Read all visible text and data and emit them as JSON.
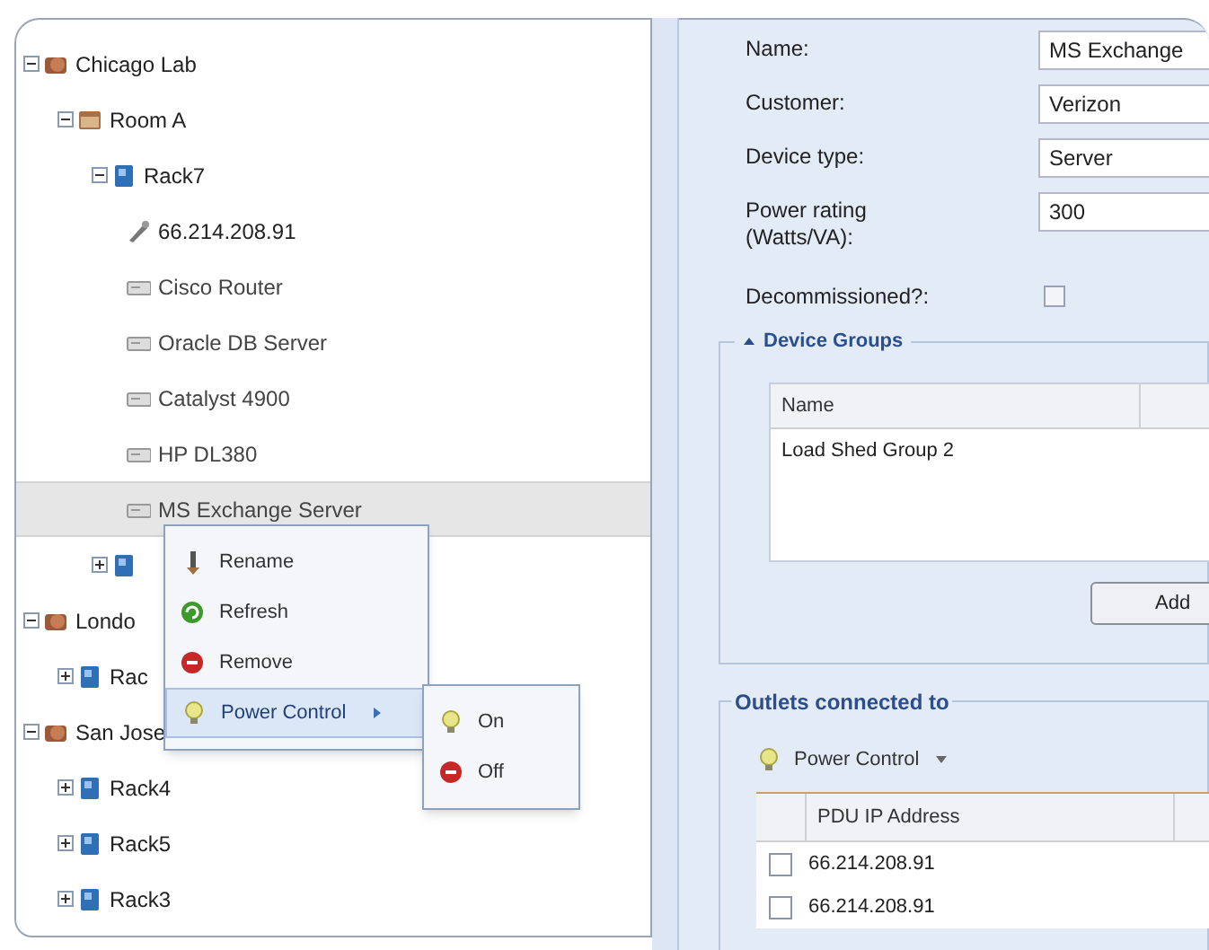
{
  "tree": [
    {
      "label": "Chicago Lab",
      "kind": "site",
      "expanded": true,
      "selected": false,
      "children": [
        {
          "label": "Room A",
          "kind": "room",
          "expanded": true,
          "selected": false,
          "children": [
            {
              "label": "Rack7",
              "kind": "rack",
              "expanded": true,
              "selected": false,
              "children": [
                {
                  "label": "66.214.208.91",
                  "kind": "pdu",
                  "selected": false
                },
                {
                  "label": "Cisco Router",
                  "kind": "device",
                  "selected": false
                },
                {
                  "label": "Oracle DB Server",
                  "kind": "device",
                  "selected": false
                },
                {
                  "label": "Catalyst 4900",
                  "kind": "device",
                  "selected": false
                },
                {
                  "label": "HP DL380",
                  "kind": "device",
                  "selected": false
                },
                {
                  "label": "MS Exchange Server",
                  "kind": "device",
                  "selected": true
                }
              ]
            },
            {
              "kind": "rack",
              "expanded": false,
              "selected": false
            }
          ]
        }
      ]
    },
    {
      "label": "Londo",
      "kind": "site",
      "expanded": true,
      "selected": false,
      "children": [
        {
          "label": "Rac",
          "kind": "rack",
          "expanded": false,
          "selected": false
        }
      ]
    },
    {
      "label": "San Jose",
      "kind": "site",
      "expanded": true,
      "selected": false,
      "children": [
        {
          "label": "Rack4",
          "kind": "rack",
          "expanded": false,
          "selected": false
        },
        {
          "label": "Rack5",
          "kind": "rack",
          "expanded": false,
          "selected": false
        },
        {
          "label": "Rack3",
          "kind": "rack",
          "expanded": false,
          "selected": false
        }
      ]
    }
  ],
  "context_menu": [
    {
      "label": "Rename",
      "kind": "rename",
      "selected": false
    },
    {
      "label": "Refresh",
      "kind": "refresh",
      "selected": false
    },
    {
      "label": "Remove",
      "kind": "remove",
      "selected": false
    },
    {
      "label": "Power Control",
      "kind": "power",
      "selected": true,
      "submenu": true
    }
  ],
  "submenu": [
    {
      "label": "On",
      "kind": "power",
      "selected": false
    },
    {
      "label": "Off",
      "kind": "remove",
      "selected": false
    }
  ],
  "fields": [
    {
      "label": "Name:",
      "value": "MS Exchange"
    },
    {
      "label": "Customer:",
      "value": "Verizon"
    },
    {
      "label": "Device type:",
      "value": "Server"
    },
    {
      "label": "Power rating (Watts/VA):",
      "value": "300"
    }
  ],
  "decommissioned": {
    "label": "Decommissioned?:",
    "checked": false
  },
  "device_groups": {
    "legend": "Device Groups",
    "expanded": true,
    "columns": [
      "Name"
    ],
    "rows": [
      "Load Shed Group 2"
    ],
    "add_button": "Add"
  },
  "outlets": {
    "legend": "Outlets connected to",
    "toolbar_button": "Power Control",
    "columns": [
      "PDU IP Address"
    ],
    "rows": [
      {
        "pdu_ip": "66.214.208.91",
        "checked": false
      },
      {
        "pdu_ip": "66.214.208.91",
        "checked": false
      }
    ]
  }
}
